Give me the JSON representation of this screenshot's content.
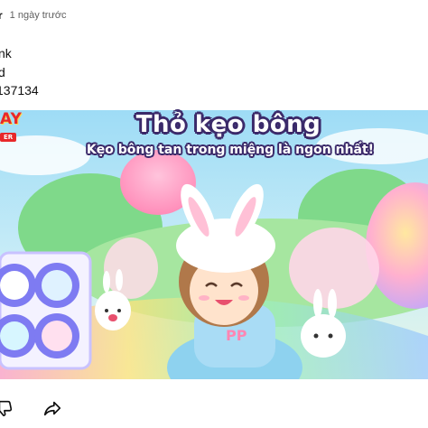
{
  "post": {
    "author_fragment": "r",
    "time_ago": "1 ngày trước",
    "lines": [
      "nk",
      "d",
      "137134"
    ]
  },
  "media": {
    "logo_top": "AY",
    "logo_bottom": "ER",
    "title": "Thỏ kẹo bông",
    "subtitle": "Kẹo bông tan trong miệng là ngon nhất!",
    "colors": {
      "sky": "#8fd3f0",
      "cotton_candy_pink": "#ff9fc4",
      "panel_border": "#c9c2ff",
      "title_outline": "#3b2a6a"
    }
  },
  "actions": {
    "dislike_icon": "thumbs-down-icon",
    "share_icon": "share-icon"
  }
}
